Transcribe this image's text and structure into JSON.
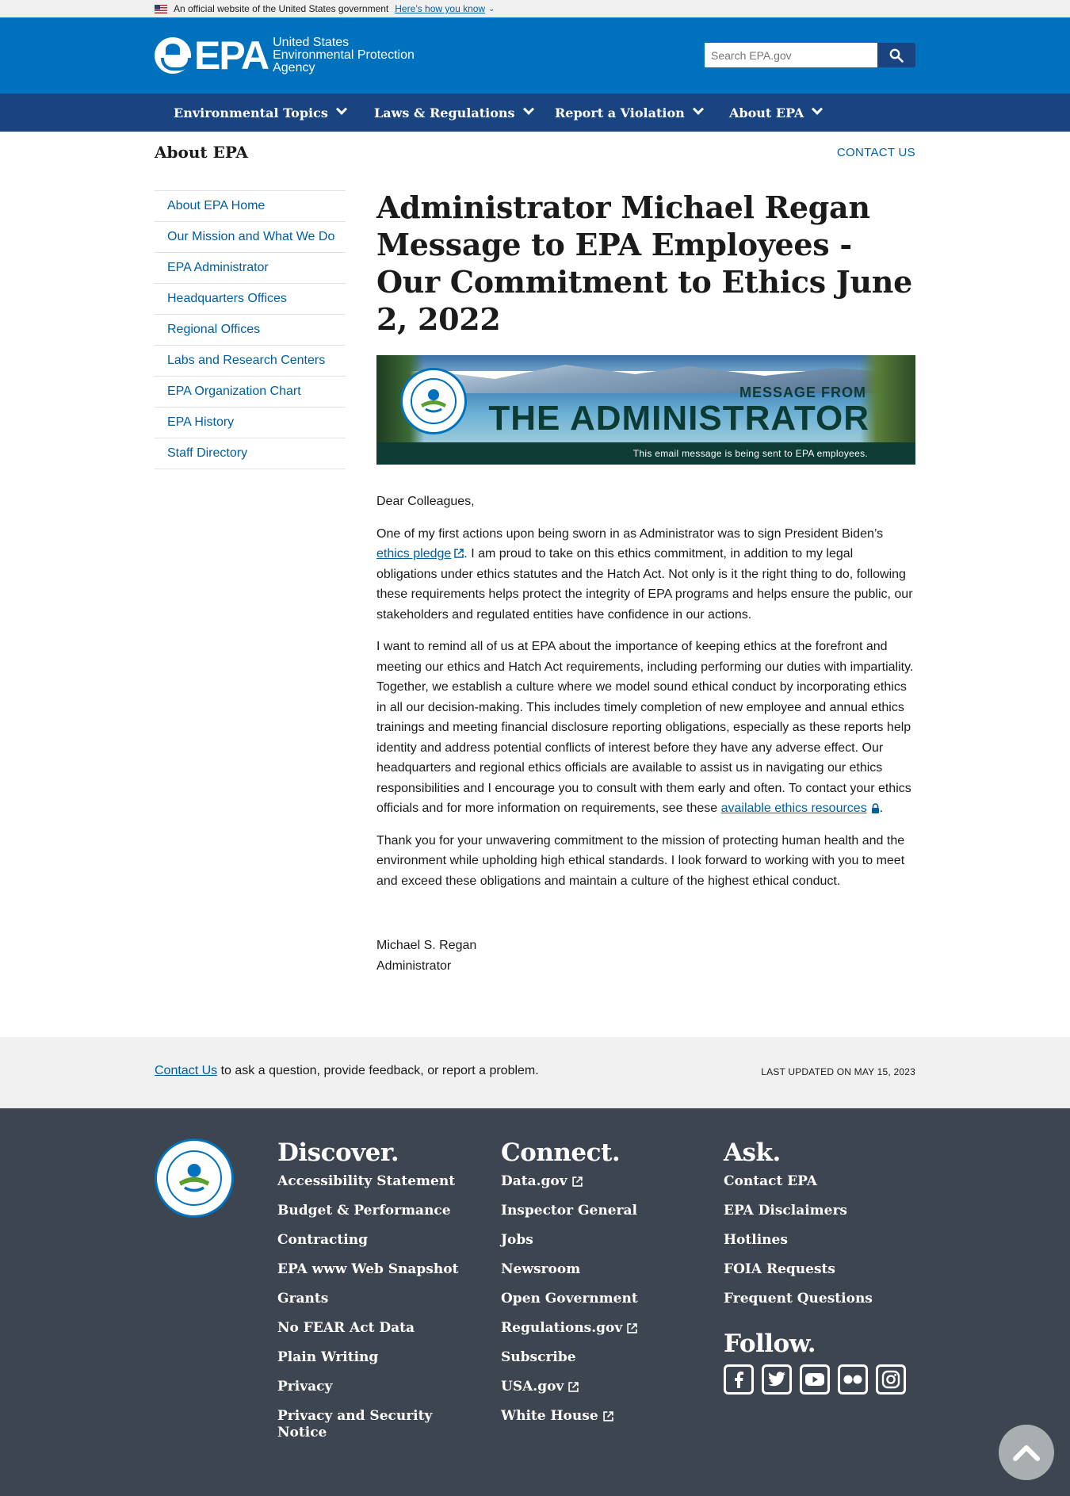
{
  "gov_banner": {
    "official_text": "An official website of the United States government",
    "how_link": "Here’s how you know"
  },
  "header": {
    "logo_epa": "EPA",
    "logo_line1": "United States",
    "logo_line2": "Environmental Protection",
    "logo_line3": "Agency",
    "search_placeholder": "Search EPA.gov"
  },
  "nav": {
    "items": [
      {
        "label": "Environmental Topics"
      },
      {
        "label": "Laws & Regulations"
      },
      {
        "label": "Report a Violation"
      },
      {
        "label": "About EPA"
      }
    ]
  },
  "section": {
    "title": "About EPA",
    "contact": "CONTACT US"
  },
  "sidebar": {
    "items": [
      {
        "label": "About EPA Home"
      },
      {
        "label": "Our Mission and What We Do"
      },
      {
        "label": "EPA Administrator"
      },
      {
        "label": "Headquarters Offices"
      },
      {
        "label": "Regional Offices"
      },
      {
        "label": "Labs and Research Centers"
      },
      {
        "label": "EPA Organization Chart"
      },
      {
        "label": "EPA History"
      },
      {
        "label": "Staff Directory"
      }
    ]
  },
  "article": {
    "title": "Administrator Michael Regan Message to EPA Employees - Our Commitment to Ethics June 2, 2022",
    "banner": {
      "message_from": "MESSAGE FROM",
      "administrator": "THE ADMINISTRATOR",
      "strip": "This email message is being sent to EPA employees."
    },
    "greeting": "Dear Colleagues,",
    "p1_a": "One of my first actions upon being sworn in as Administrator was to sign President Biden’s ",
    "p1_link": "ethics pledge",
    "p1_b": ". I am proud to take on this ethics commitment, in addition to my legal obligations under ethics statutes and the Hatch Act.  Not only is it the right thing to do, following these requirements helps protect the integrity of EPA programs and helps ensure the public, our stakeholders and regulated entities have confidence in our actions.",
    "p2_a": "I want to remind all of us at EPA about the importance of keeping ethics at the forefront and meeting our ethics and Hatch Act requirements, including performing our duties with impartiality. Together, we establish a culture where we model sound ethical conduct by incorporating ethics in all our decision-making. This includes timely completion of new employee and annual ethics trainings and meeting financial disclosure reporting obligations, especially as these reports help identity and address potential conflicts of interest before they have any adverse effect. Our headquarters and regional ethics officials are available to assist us in navigating our ethics responsibilities and I encourage you to consult with them early and often. To contact your ethics officials and for more information on requirements, see these ",
    "p2_link": "available ethics resources",
    "p2_b": ".",
    "p3": "Thank you for your unwavering commitment to the mission of protecting human health and the environment while upholding high ethical standards. I look forward to working with you to meet and exceed these obligations and maintain a culture of the highest ethical conduct.",
    "sig_name": "Michael S. Regan",
    "sig_title": "Administrator"
  },
  "band": {
    "contact_link": "Contact Us",
    "contact_rest": " to ask a question, provide feedback, or report a problem.",
    "updated": "LAST UPDATED ON MAY 15, 2023"
  },
  "footer": {
    "discover": {
      "heading": "Discover.",
      "links": [
        {
          "label": "Accessibility Statement"
        },
        {
          "label": "Budget & Performance"
        },
        {
          "label": "Contracting"
        },
        {
          "label": "EPA www Web Snapshot"
        },
        {
          "label": "Grants"
        },
        {
          "label": "No FEAR Act Data"
        },
        {
          "label": "Plain Writing"
        },
        {
          "label": "Privacy"
        },
        {
          "label": "Privacy and Security Notice"
        }
      ]
    },
    "connect": {
      "heading": "Connect.",
      "links": [
        {
          "label": "Data.gov"
        },
        {
          "label": "Inspector General"
        },
        {
          "label": "Jobs"
        },
        {
          "label": "Newsroom"
        },
        {
          "label": "Open Government"
        },
        {
          "label": "Regulations.gov"
        },
        {
          "label": "Subscribe"
        },
        {
          "label": "USA.gov"
        },
        {
          "label": "White House"
        }
      ]
    },
    "ask": {
      "heading": "Ask.",
      "links": [
        {
          "label": "Contact EPA"
        },
        {
          "label": "EPA Disclaimers"
        },
        {
          "label": "Hotlines"
        },
        {
          "label": "FOIA Requests"
        },
        {
          "label": "Frequent Questions"
        }
      ]
    },
    "follow": {
      "heading": "Follow.",
      "icons": [
        "facebook-icon",
        "twitter-icon",
        "youtube-icon",
        "flickr-icon",
        "instagram-icon"
      ]
    }
  },
  "colors": {
    "header_blue": "#0071bc",
    "nav_blue": "#1a4480",
    "link_blue": "#005ea2",
    "footer_bg": "#3d4551"
  }
}
